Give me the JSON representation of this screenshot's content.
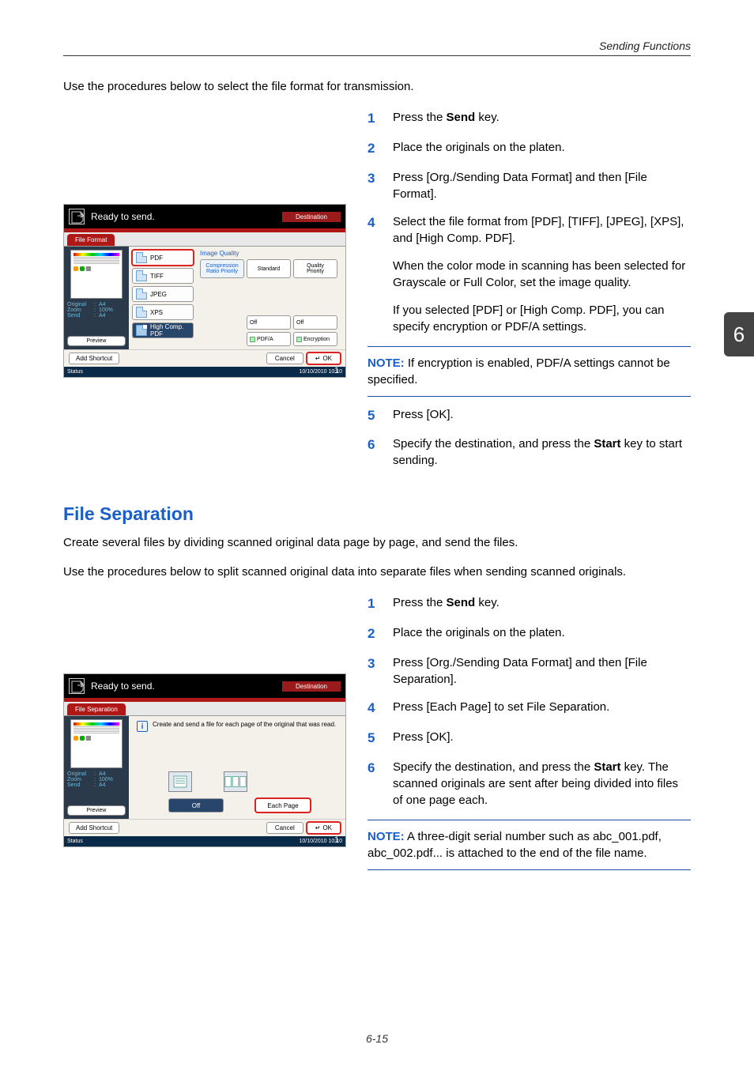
{
  "header": {
    "section": "Sending Functions"
  },
  "chapter_tab": "6",
  "page_number": "6-15",
  "intro1": "Use the procedures below to select the file format for transmission.",
  "steps1": {
    "s1_pre": "Press the ",
    "s1_b": "Send",
    "s1_post": " key.",
    "s2": "Place the originals on the platen.",
    "s3": "Press [Org./Sending Data Format] and then [File Format].",
    "s4a": "Select the file format from [PDF], [TIFF], [JPEG], [XPS], and [High Comp. PDF].",
    "s4b": "When the color mode in scanning has been selected for Grayscale or Full Color, set the image quality.",
    "s4c": "If you selected [PDF] or [High Comp. PDF], you can specify encryption or PDF/A settings.",
    "s5": "Press [OK].",
    "s6_pre": "Specify the destination, and press the ",
    "s6_b": "Start",
    "s6_post": " key to start sending."
  },
  "note1": {
    "label": "NOTE:",
    "text": " If encryption is enabled, PDF/A settings cannot be specified."
  },
  "section2_title": "File Separation",
  "intro2a": "Create several files by dividing scanned original data page by page, and send the files.",
  "intro2b": "Use the procedures below to split scanned original data into separate files when sending scanned originals.",
  "steps2": {
    "s1_pre": "Press the ",
    "s1_b": "Send",
    "s1_post": " key.",
    "s2": "Place the originals on the platen.",
    "s3": "Press [Org./Sending Data Format] and then [File Separation].",
    "s4": "Press [Each Page] to set File Separation.",
    "s5": "Press [OK].",
    "s6_pre": "Specify the destination, and press the ",
    "s6_b": "Start",
    "s6_post": " key. The scanned originals are sent after being divided into files of one page each."
  },
  "note2": {
    "label": "NOTE:",
    "text": "  A three-digit serial number such as abc_001.pdf, abc_002.pdf... is attached to the end of the file name."
  },
  "panel_common": {
    "ready": "Ready to send.",
    "destination": "Destination",
    "dest_count": "1",
    "status": "Status",
    "timestamp": "10/10/2010   10:10",
    "add_shortcut": "Add Shortcut",
    "cancel": "Cancel",
    "ok": "OK",
    "preview": "Preview",
    "side": {
      "original": "Original",
      "zoom": "Zoom",
      "send": "Send",
      "a4": "A4",
      "pct": "100%",
      "sep": ":"
    }
  },
  "panel1": {
    "tab": "File Format",
    "formats": {
      "pdf": "PDF",
      "tiff": "TIFF",
      "jpeg": "JPEG",
      "xps": "XPS",
      "hc_l1": "High Comp.",
      "hc_l2": "PDF"
    },
    "iq_label": "Image Quality",
    "iq": {
      "b1_l1": "Compression",
      "b1_l2": "Ratio Priority",
      "b2": "Standard",
      "b3_l1": "Quality",
      "b3_l2": "Priority"
    },
    "row2": {
      "off1": "Off",
      "off2": "Off",
      "pdfa": "PDF/A",
      "enc": "Encryption"
    }
  },
  "panel2": {
    "tab": "File Separation",
    "info": "Create and send a file for each page of the original that was read.",
    "off": "Off",
    "each": "Each Page"
  }
}
